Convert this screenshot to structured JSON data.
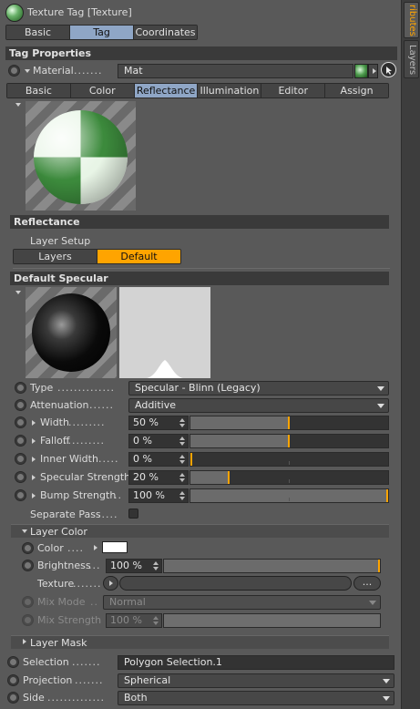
{
  "header": {
    "title": "Texture Tag [Texture]",
    "tabs": [
      "Basic",
      "Tag",
      "Coordinates"
    ],
    "selected_tab": "Tag"
  },
  "side_tabs": [
    "ributes",
    "Layers"
  ],
  "tag_properties": {
    "title": "Tag Properties",
    "material_label": "Material",
    "material_value": "Mat",
    "material_tabs": [
      "Basic",
      "Color",
      "Reflectance",
      "Illumination",
      "Editor",
      "Assign"
    ],
    "selected_material_tab": "Reflectance"
  },
  "reflectance": {
    "title": "Reflectance",
    "layer_setup_label": "Layer Setup",
    "layer_tabs": [
      "Layers",
      "Default Specular"
    ],
    "selected_layer_tab": "Default Specular"
  },
  "default_specular": {
    "title": "Default Specular",
    "type_label": "Type",
    "type_value": "Specular - Blinn (Legacy)",
    "attenuation_label": "Attenuation",
    "attenuation_value": "Additive",
    "params": [
      {
        "label": "Width",
        "value": "50 %",
        "level": 0.5
      },
      {
        "label": "Falloff",
        "value": "0 %",
        "level": 0.5
      },
      {
        "label": "Inner Width",
        "value": "0 %",
        "level": 0.0
      },
      {
        "label": "Specular Strength",
        "value": "20 %",
        "level": 0.2
      },
      {
        "label": "Bump Strength",
        "value": "100 %",
        "level": 1.0
      }
    ],
    "separate_pass_label": "Separate Pass"
  },
  "layer_color": {
    "title": "Layer Color",
    "color_label": "Color",
    "color_swatch": "#ffffff",
    "brightness_label": "Brightness",
    "brightness_value": "100 %",
    "brightness_level": 1.0,
    "texture_label": "Texture",
    "texture_button": "...",
    "mix_mode_label": "Mix Mode",
    "mix_mode_value": "Normal",
    "mix_strength_label": "Mix Strength",
    "mix_strength_value": "100 %"
  },
  "layer_mask": {
    "title": "Layer Mask"
  },
  "selection_label": "Selection",
  "selection_value": "Polygon Selection.1",
  "projection_label": "Projection",
  "projection_value": "Spherical",
  "side_label": "Side",
  "side_value": "Both",
  "colors": {
    "accent": "#ffa400",
    "selected_tab": "#8fa6c6",
    "panel": "#595959",
    "header": "#3a3a3a"
  }
}
